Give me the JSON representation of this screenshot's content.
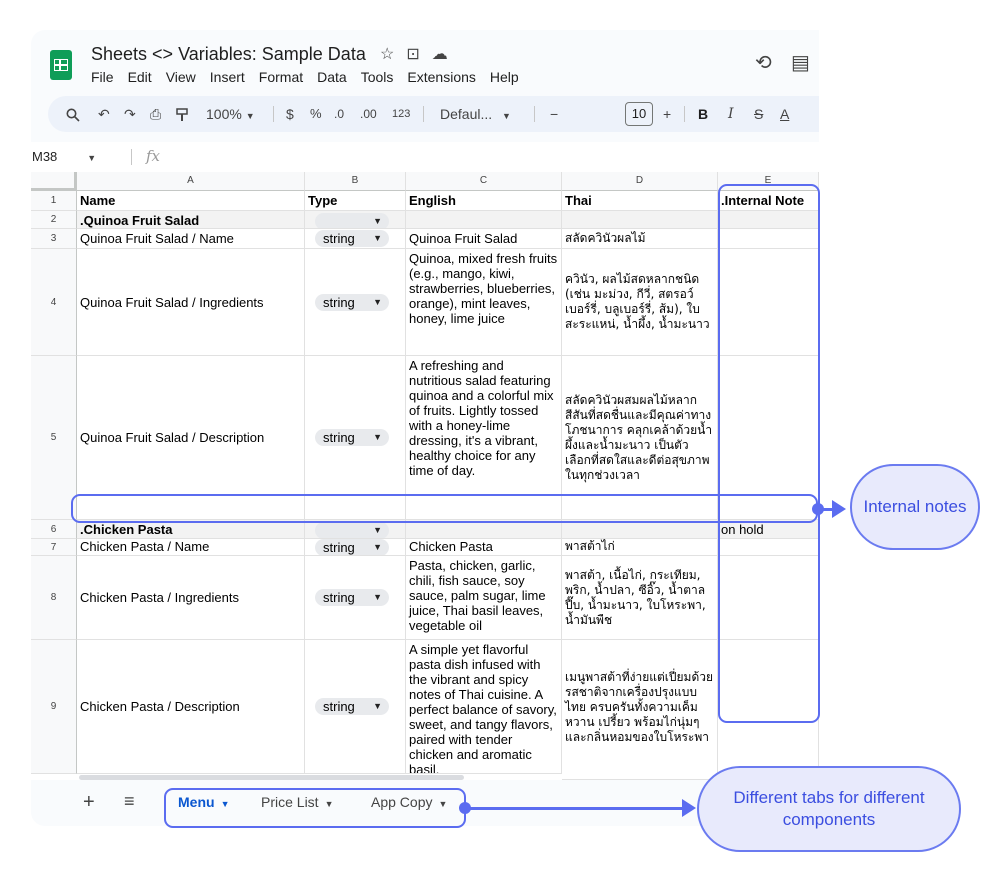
{
  "app": {
    "doc_title": "Sheets <> Variables: Sample Data",
    "title_icons": [
      "star-icon",
      "folder-icon",
      "cloud-icon"
    ],
    "menu": [
      "File",
      "Edit",
      "View",
      "Insert",
      "Format",
      "Data",
      "Tools",
      "Extensions",
      "Help"
    ],
    "history_icon": "history-icon",
    "comments_icon": "comments-icon"
  },
  "toolbar": {
    "search": "Q",
    "undo": "↶",
    "redo": "↷",
    "print": "⎙",
    "paint": "🖌",
    "zoom": "100%",
    "currency": "$",
    "percent": "%",
    "dec_decrease": ".0",
    "dec_increase": ".00",
    "number_format": "123",
    "font": "Defaul...",
    "minus": "−",
    "font_size": "10",
    "plus": "+",
    "bold": "B",
    "italic": "I",
    "strike": "S",
    "text_color": "A"
  },
  "formula_bar": {
    "cell_ref": "M38",
    "fx": "fx"
  },
  "columns": [
    "A",
    "B",
    "C",
    "D",
    "E"
  ],
  "rows": [
    {
      "num": "1",
      "a": "Name",
      "b": "Type",
      "c": "English",
      "d": "Thai",
      "e": ".Internal Note"
    },
    {
      "num": "2",
      "a": ".Quinoa Fruit Salad",
      "b": "",
      "c": "",
      "d": "",
      "e": ""
    },
    {
      "num": "3",
      "a": "Quinoa Fruit Salad / Name",
      "b": "string",
      "c": "Quinoa Fruit Salad",
      "d": "สลัดควินัวผลไม้",
      "e": ""
    },
    {
      "num": "4",
      "a": "Quinoa Fruit Salad / Ingredients",
      "b": "string",
      "c": "Quinoa, mixed fresh fruits (e.g., mango, kiwi, strawberries, blueberries, orange), mint leaves, honey, lime juice",
      "d": "ควินัว, ผลไม้สดหลากชนิด (เช่น มะม่วง, กีวี่, สตรอว์เบอร์รี่, บลูเบอร์รี่, ส้ม), ใบสะระแหน่, น้ำผึ้ง, น้ำมะนาว",
      "e": ""
    },
    {
      "num": "5",
      "a": "Quinoa Fruit Salad / Description",
      "b": "string",
      "c": "A refreshing and nutritious salad featuring quinoa and a colorful mix of fruits. Lightly tossed with a honey-lime dressing, it's a vibrant, healthy choice for any time of day.",
      "d": "สลัดควินัวผสมผลไม้หลากสีสันที่สดชื่นและมีคุณค่าทางโภชนาการ คลุกเคล้าด้วยน้ำผึ้งและน้ำมะนาว เป็นตัวเลือกที่สดใสและดีต่อสุขภาพในทุกช่วงเวลา",
      "e": ""
    },
    {
      "num": "6",
      "a": ".Chicken Pasta",
      "b": "",
      "c": "",
      "d": "",
      "e": "on hold"
    },
    {
      "num": "7",
      "a": "Chicken Pasta / Name",
      "b": "string",
      "c": "Chicken Pasta",
      "d": "พาสต้าไก่",
      "e": ""
    },
    {
      "num": "8",
      "a": "Chicken Pasta / Ingredients",
      "b": "string",
      "c": "Pasta, chicken, garlic, chili, fish sauce, soy sauce, palm sugar, lime juice, Thai basil leaves, vegetable oil",
      "d": "พาสต้า, เนื้อไก่, กระเทียม, พริก, น้ำปลา, ซีอิ๊ว, น้ำตาลปี๊บ, น้ำมะนาว, ใบโหระพา, น้ำมันพืช",
      "e": ""
    },
    {
      "num": "9",
      "a": "Chicken Pasta / Description",
      "b": "string",
      "c": "A simple yet flavorful pasta dish infused with the vibrant and spicy notes of Thai cuisine. A perfect balance of savory, sweet, and tangy flavors, paired with tender chicken and aromatic basil.",
      "d": "เมนูพาสต้าที่ง่ายแต่เปี่ยมด้วยรสชาติจากเครื่องปรุงแบบไทย ครบครันทั้งความเค็ม หวาน เปรี้ยว พร้อมไก่นุ่มๆ และกลิ่นหอมของใบโหระพา",
      "e": ""
    }
  ],
  "tabs": [
    {
      "label": "Menu",
      "active": true
    },
    {
      "label": "Price List",
      "active": false
    },
    {
      "label": "App Copy",
      "active": false
    }
  ],
  "annotations": {
    "internal_notes": "Internal notes",
    "tabs_note": "Different tabs for different components",
    "accent": "#5b6cf0",
    "bubble_fill": "#e8eafc"
  }
}
